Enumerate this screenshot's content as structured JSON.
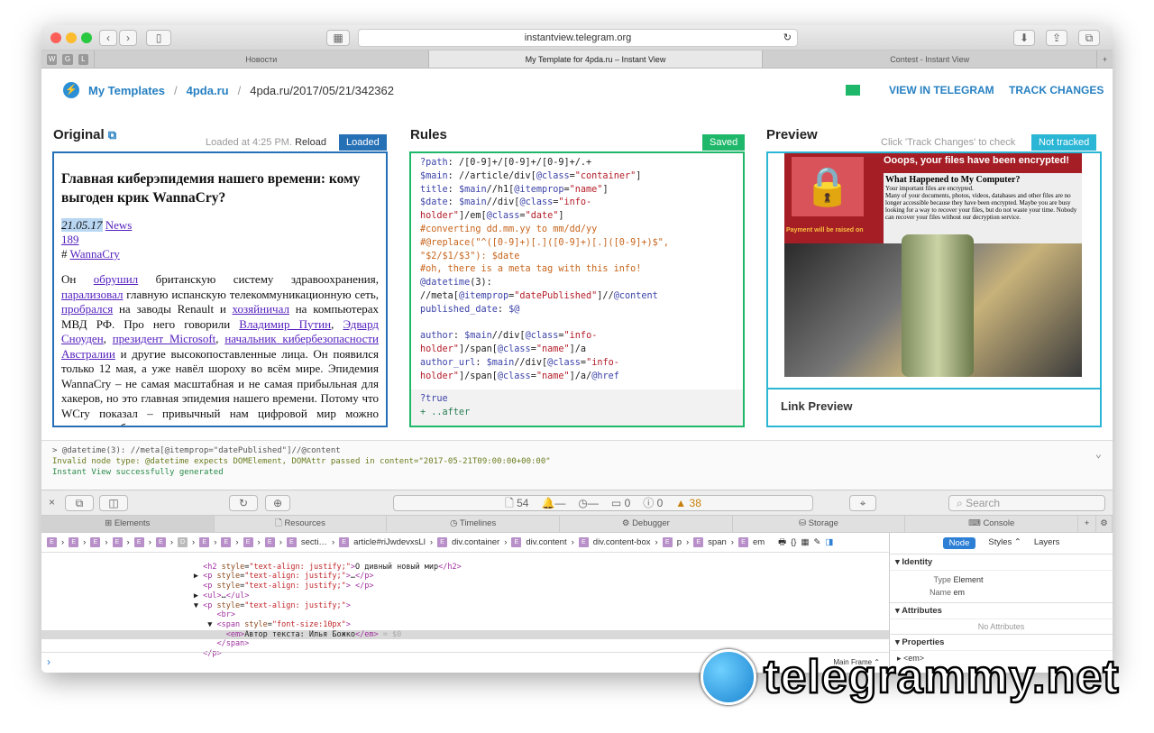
{
  "browser": {
    "url": "instantview.telegram.org",
    "tabs": [
      "Новости",
      "My Template for 4pda.ru – Instant View",
      "Contest - Instant View"
    ],
    "pinned": [
      "W",
      "G",
      "L"
    ]
  },
  "header": {
    "breadcrumb": [
      "My Templates",
      "4pda.ru",
      "4pda.ru/2017/05/21/342362"
    ],
    "view_in_telegram": "VIEW IN TELEGRAM",
    "track_changes": "TRACK CHANGES"
  },
  "original": {
    "title": "Original",
    "loaded_at": "Loaded at 4:25 PM.",
    "reload": "Reload",
    "status": "Loaded",
    "article": {
      "headline": "Главная киберэпидемия нашего времени: кому выгоден крик WannaCry?",
      "date": "21.05.17",
      "category": "News",
      "comments": "189",
      "tag_prefix": "#",
      "tag": "WannaCry",
      "body": [
        "Он ",
        "обрушил",
        " британскую систему здравоохранения, ",
        "парализовал",
        " главную испанскую телекоммуникационную сеть, ",
        "пробрался",
        " на заводы Renault и ",
        "хозяйничал",
        " на компьютерах МВД РФ. Про него говорили ",
        "Владимир Путин",
        ", ",
        "Эдвард Сноуден",
        ", ",
        "президент Microsoft",
        ", ",
        "начальник кибербезопасности Австралии",
        " и другие высокопоставленные лица. Он появился только 12 мая, а уже навёл шороху во всём мире. Эпидемия WannaCry – не самая масштабная и не самая прибыльная для хакеров, но это главная эпидемия нашего времени. Потому что WCry показал – привычный нам цифровой мир можно выключить буквально щелчком пальцев."
      ]
    }
  },
  "rules": {
    "title": "Rules",
    "status": "Saved"
  },
  "preview": {
    "title": "Preview",
    "hint": "Click 'Track Changes' to check",
    "status": "Not tracked",
    "image_text": [
      "Ooops, your files have been encrypted!",
      "What Happened to My Computer?",
      "Your important files are encrypted.",
      "Many of your documents, photos, videos, databases and other files are no longer accessible because they have been encrypted. Maybe you are busy looking for a way to recover your files, but do not waste your time. Nobody can recover your files without our decryption service.",
      "Payment will be raised on"
    ],
    "link_preview": "Link Preview"
  },
  "console": {
    "lines": [
      "> @datetime(3): //meta[@itemprop=\"datePublished\"]//@content",
      "Invalid node type: @datetime expects DOMElement, DOMAttr passed in  content=\"2017-05-21T09:00:00+00:00\"",
      "Instant View successfully generated"
    ]
  },
  "devtools": {
    "resources_count": "54",
    "dash1": "—",
    "dash2": "—",
    "messages": "0",
    "errors": "0",
    "warnings": "38",
    "search_placeholder": "Search",
    "tabs": [
      "Elements",
      "Resources",
      "Timelines",
      "Debugger",
      "Storage",
      "Console"
    ],
    "crumbs": [
      "secti…",
      "article#riJwdevxsLl",
      "div.container",
      "div.content",
      "div.content-box",
      "p",
      "span",
      "em"
    ],
    "sidebar": {
      "tabs": [
        "Node",
        "Styles ⌃",
        "Layers"
      ],
      "identity": "Identity",
      "type_label": "Type",
      "type_value": "Element",
      "name_label": "Name",
      "name_value": "em",
      "attributes": "Attributes",
      "no_attributes": "No Attributes",
      "properties": "Properties",
      "prop_item": "<em>"
    },
    "main_frame": "Main Frame ⌃"
  },
  "watermark": "telegrammy.net",
  "colors": {
    "accent": "#2680c2",
    "saved": "#1fb86a",
    "not_tracked": "#2bb6d6"
  }
}
